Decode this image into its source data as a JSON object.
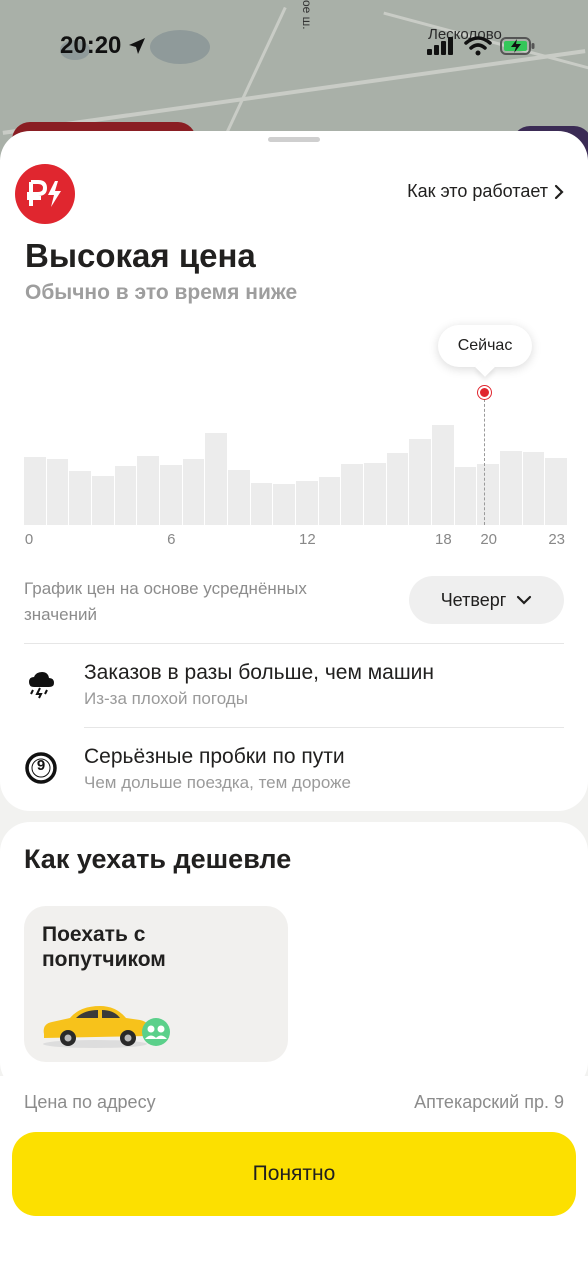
{
  "status_bar": {
    "time": "20:20"
  },
  "map": {
    "place_label": "Лесколово",
    "street_label": "ое ш."
  },
  "header": {
    "how_it_works": "Как это работает"
  },
  "surge": {
    "title": "Высокая цена",
    "subtitle": "Обычно в это время ниже",
    "now_label": "Сейчас",
    "note": "График цен на основе усреднённых значений",
    "day_selector": "Четверг"
  },
  "chart_data": {
    "type": "bar",
    "categories": [
      "0",
      "1",
      "2",
      "3",
      "4",
      "5",
      "6",
      "7",
      "8",
      "9",
      "10",
      "11",
      "12",
      "13",
      "14",
      "15",
      "16",
      "17",
      "18",
      "19",
      "20",
      "21",
      "22",
      "23"
    ],
    "values": [
      67,
      65,
      53,
      48,
      58,
      68,
      59,
      65,
      90,
      54,
      41,
      40,
      43,
      47,
      60,
      61,
      71,
      84,
      98,
      57,
      60,
      73,
      72,
      66
    ],
    "tick_labels": [
      "0",
      "6",
      "12",
      "18",
      "20",
      "23"
    ],
    "highlight_hour": 20,
    "ylim": [
      0,
      210
    ],
    "grid": false
  },
  "reasons": [
    {
      "icon": "storm-cloud-icon",
      "title": "Заказов в разы больше, чем машин",
      "subtitle": "Из-за плохой погоды"
    },
    {
      "icon": "traffic-icon",
      "title": "Серьёзные пробки по пути",
      "subtitle": "Чем дольше поездка, тем дороже",
      "badge": "9"
    }
  ],
  "cheaper": {
    "heading": "Как уехать дешевле",
    "option_title": "Поехать с попутчиком"
  },
  "footer": {
    "address_label": "Цена по адресу",
    "address_value": "Аптекарский пр. 9",
    "ok_button": "Понятно"
  },
  "colors": {
    "accent_red": "#e0262f",
    "button_yellow": "#fce000"
  }
}
